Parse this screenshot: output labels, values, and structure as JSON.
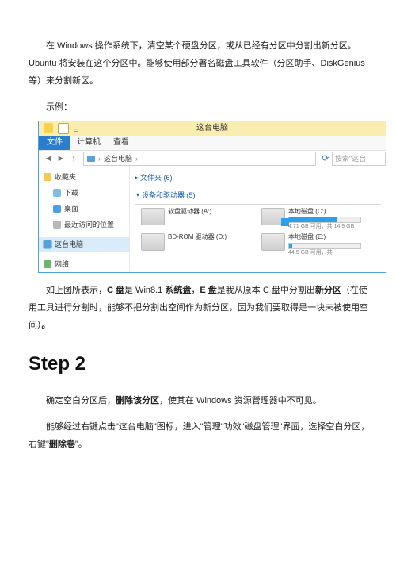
{
  "para1": "在 Windows 操作系统下，清空某个硬盘分区，或从已经有分区中分割出新分区。Ubuntu 将安装在这个分区中。能够使用部分著名磁盘工具软件（分区助手、DiskGenius 等）来分割新区。",
  "example_label": "示例：",
  "explorer": {
    "title": "这台电脑",
    "menu": {
      "file": "文件",
      "computer": "计算机",
      "view": "查看"
    },
    "addr": {
      "crumb1": "这台电脑",
      "search_ph": "搜索\"这台"
    },
    "sidebar": {
      "fav": "收藏夹",
      "down": "下载",
      "desk": "桌面",
      "recent": "最近访问的位置",
      "thispc": "这台电脑",
      "network": "网络"
    },
    "groups": {
      "folders": "文件夹 (6)",
      "devices": "设备和驱动器 (5)"
    },
    "drives": {
      "floppy": "软盘驱动器 (A:)",
      "c": {
        "name": "本地磁盘 (C:)",
        "sub": "4.71 GB 可用，共 14.9 GB",
        "fill": 68
      },
      "bd": "BD-ROM 驱动器 (D:)",
      "e": {
        "name": "本地磁盘 (E:)",
        "sub": "44.5 GB 可用，共",
        "fill": 4
      }
    }
  },
  "para2_a": "如上图所表示，",
  "para2_b": "C 盘",
  "para2_c": "是 Win8.1 ",
  "para2_d": "系统盘",
  "para2_e": "，",
  "para2_f": "E 盘",
  "para2_g": "是我从原本 C 盘中分割出",
  "para2_h": "新分区",
  "para2_i": "（在使用工具进行分割时，能够不把分割出空间作为新分区，因为我们要取得是一块未被使用空间）",
  "para2_j": "。",
  "step2_title": "Step 2",
  "para3_a": "确定空白分区后，",
  "para3_b": "删除该分区",
  "para3_c": "，使其在 Windows 资源管理器中不可见。",
  "para4_a": "能够经过右键点击\"这台电脑\"图标，进入\"管理\"功效\"磁盘管理\"界面，选择空白分区，右键\"",
  "para4_b": "删除卷",
  "para4_c": "\"。"
}
